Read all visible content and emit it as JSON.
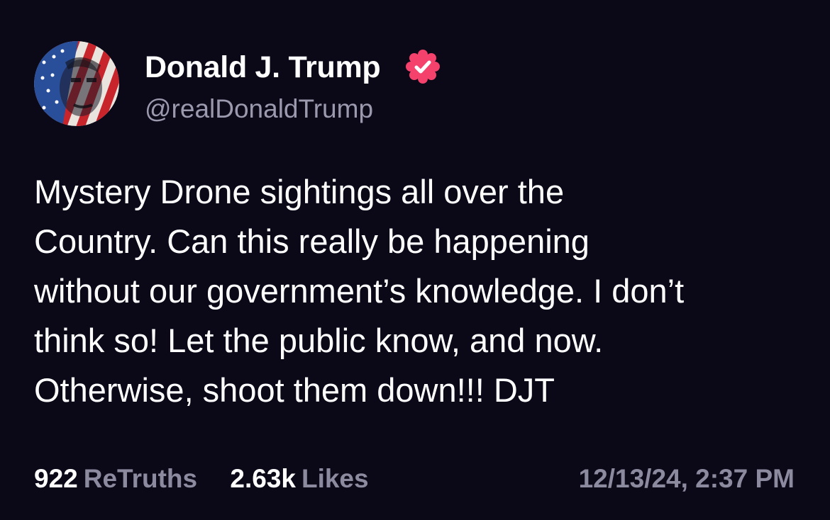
{
  "post": {
    "author": {
      "display_name": "Donald J. Trump",
      "handle": "@realDonaldTrump",
      "verified_icon": "verified-badge-icon",
      "avatar": "profile-avatar"
    },
    "text": "Mystery Drone sightings all over the\nCountry. Can this really be happening\nwithout our government’s knowledge. I don’t\nthink so! Let the public know, and now.\nOtherwise, shoot them down!!! DJT",
    "stats": {
      "retruths_count": "922",
      "retruths_label": "ReTruths",
      "likes_count": "2.63k",
      "likes_label": "Likes"
    },
    "timestamp": "12/13/24, 2:37 PM"
  },
  "colors": {
    "background": "#0b0818",
    "text": "#ffffff",
    "secondary_text": "#8c8a9e",
    "verified_badge": "#f4426c"
  }
}
